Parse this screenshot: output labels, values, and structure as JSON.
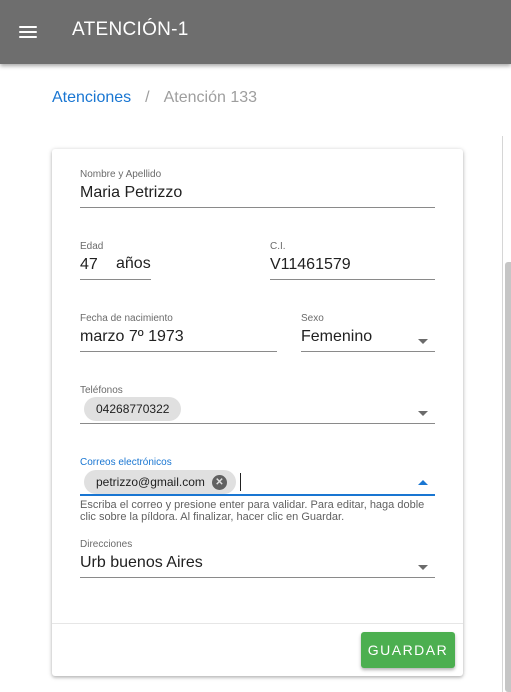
{
  "appbar": {
    "title": "ATENCIÓN-1",
    "menu_icon": "menu-icon"
  },
  "breadcrumb": {
    "parent": "Atenciones",
    "separator": "/",
    "current": "Atención 133"
  },
  "form": {
    "name": {
      "label": "Nombre y Apellido",
      "value": "Maria Petrizzo"
    },
    "age": {
      "label": "Edad",
      "value": "47",
      "suffix": "años"
    },
    "ci": {
      "label": "C.I.",
      "value": "V11461579"
    },
    "birth_date": {
      "label": "Fecha de nacimiento",
      "value": "marzo 7º 1973"
    },
    "sex": {
      "label": "Sexo",
      "value": "Femenino"
    },
    "phones": {
      "label": "Teléfonos",
      "chips": [
        "04268770322"
      ]
    },
    "emails": {
      "label": "Correos electrónicos",
      "chips": [
        "petrizzo@gmail.com"
      ],
      "hint": "Escriba el correo y presione enter para validar. Para editar, haga doble clic sobre la píldora. Al finalizar, hacer clic en Guardar."
    },
    "address": {
      "label": "Direcciones",
      "value": "Urb buenos Aires"
    }
  },
  "actions": {
    "save_label": "GUARDAR"
  },
  "colors": {
    "appbar": "#6e6e6e",
    "link": "#1976d2",
    "focus": "#1976d2",
    "save_button": "#4caf50",
    "chip": "#e0e0e0"
  }
}
